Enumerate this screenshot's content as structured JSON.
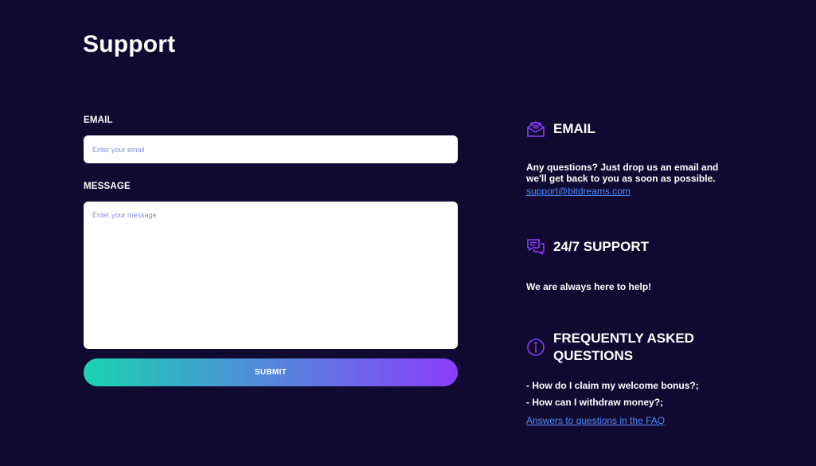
{
  "page": {
    "title": "Support"
  },
  "form": {
    "email_label": "EMAIL",
    "email_placeholder": "Enter your email",
    "email_value": "",
    "message_label": "MESSAGE",
    "message_placeholder": "Enter your message",
    "message_value": "",
    "submit_label": "SUBMIT"
  },
  "info": {
    "email": {
      "icon": "envelope-icon",
      "title": "EMAIL",
      "text": "Any questions? Just drop us an email and we'll get back to you as soon as possible.",
      "link": "support@bitdreams.com"
    },
    "support": {
      "icon": "chat-bubbles-icon",
      "title": "24/7 SUPPORT",
      "text": "We are always here to help!"
    },
    "faq": {
      "icon": "info-circle-icon",
      "title": "FREQUENTLY ASKED QUESTIONS",
      "items": [
        "- How do I claim my welcome bonus?;",
        "- How can I withdraw money?;"
      ],
      "link": "Answers to questions in the FAQ"
    }
  },
  "colors": {
    "background": "#100a30",
    "icon_accent": "#8a3dfa",
    "link": "#4f8cff",
    "gradient_start": "#1ad3b0",
    "gradient_end": "#8a3dfa"
  }
}
